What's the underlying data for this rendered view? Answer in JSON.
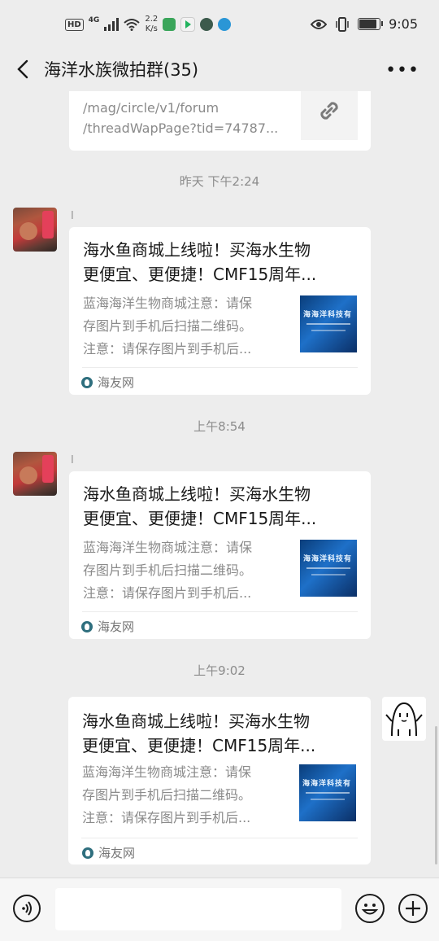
{
  "status_bar": {
    "hd": "HD",
    "network": "4G",
    "speed": "2.2\nK/s",
    "time": "9:05"
  },
  "header": {
    "title": "海洋水族微拍群(35)",
    "more": "•••"
  },
  "top_link_card": {
    "line1": "/mag/circle/v1/forum",
    "line2": "/threadWapPage?tid=74787..."
  },
  "messages": [
    {
      "timestamp": "昨天 下午2:24",
      "sender": "I",
      "title_line1": "海水鱼商城上线啦！买海水生物",
      "title_line2": "更便宜、更便捷！CMF15周年...",
      "desc_line1": "蓝海海洋生物商城注意：请保",
      "desc_line2": "存图片到手机后扫描二维码。",
      "desc_line3": "注意：请保存图片到手机后...",
      "thumb_text": "海海洋科技有",
      "source": "海友网"
    },
    {
      "timestamp": "上午8:54",
      "sender": "I",
      "title_line1": "海水鱼商城上线啦！买海水生物",
      "title_line2": "更便宜、更便捷！CMF15周年...",
      "desc_line1": "蓝海海洋生物商城注意：请保",
      "desc_line2": "存图片到手机后扫描二维码。",
      "desc_line3": "注意：请保存图片到手机后...",
      "thumb_text": "海海洋科技有",
      "source": "海友网"
    },
    {
      "timestamp": "上午9:02",
      "title_line1": "海水鱼商城上线啦！买海水生物",
      "title_line2": "更便宜、更便捷！CMF15周年...",
      "desc_line1": "蓝海海洋生物商城注意：请保",
      "desc_line2": "存图片到手机后扫描二维码。",
      "desc_line3": "注意：请保存图片到手机后...",
      "thumb_text": "海海洋科技有",
      "source": "海友网"
    }
  ],
  "colors": {
    "background": "#ededed",
    "card": "#ffffff",
    "secondary_text": "#8a8a8a"
  },
  "icons": {
    "back": "chevron-left-icon",
    "more": "more-icon",
    "link": "link-icon",
    "voice": "voice-icon",
    "emoji": "emoji-icon",
    "plus": "plus-icon"
  }
}
